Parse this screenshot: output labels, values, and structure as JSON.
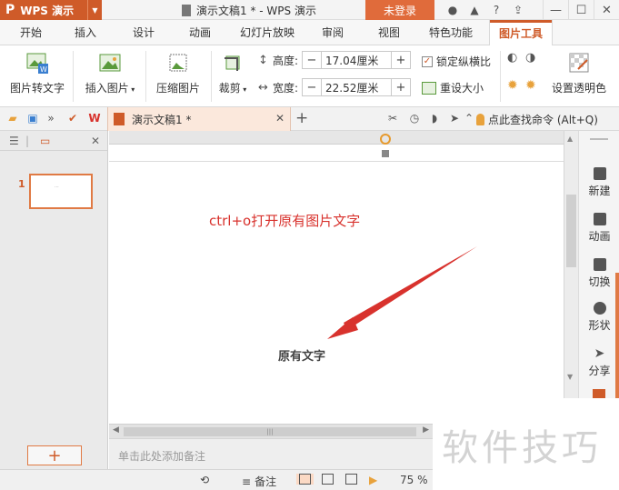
{
  "titlebar": {
    "app_logo": "P",
    "app_name": "WPS 演示",
    "doc_title": "演示文稿1 * - WPS 演示",
    "login_label": "未登录",
    "icons": [
      "skin-icon",
      "shirt-icon",
      "help-icon",
      "upload-icon"
    ],
    "help_label": "?"
  },
  "tabs": [
    "开始",
    "插入",
    "设计",
    "动画",
    "幻灯片放映",
    "审阅",
    "视图",
    "特色功能",
    "图片工具"
  ],
  "active_tab": "图片工具",
  "ribbon": {
    "pic_to_text": "图片转文字",
    "insert_pic": "插入图片",
    "compress_pic": "压缩图片",
    "crop": "裁剪",
    "height_label": "高度:",
    "height_value": "17.04厘米",
    "width_label": "宽度:",
    "width_value": "22.52厘米",
    "lock_ratio": "锁定纵横比",
    "reset_size": "重设大小",
    "set_transparent": "设置透明色",
    "minus": "−",
    "plus": "+"
  },
  "qbar": {
    "doc_tab_title": "演示文稿1 *",
    "find_command": "点此查找命令 (Alt+Q)"
  },
  "left_panel": {
    "slide_number": "1",
    "add_label": "+"
  },
  "slide": {
    "annotation": "ctrl+o打开原有图片文字",
    "original_text": "原有文字",
    "accent_color": "#d8322d"
  },
  "right_bar": [
    "新建",
    "动画",
    "切换",
    "形状",
    "分享"
  ],
  "notes_placeholder": "单击此处添加备注",
  "status": {
    "notes_label": "备注",
    "zoom": "75 %"
  },
  "watermark": "软件技巧"
}
